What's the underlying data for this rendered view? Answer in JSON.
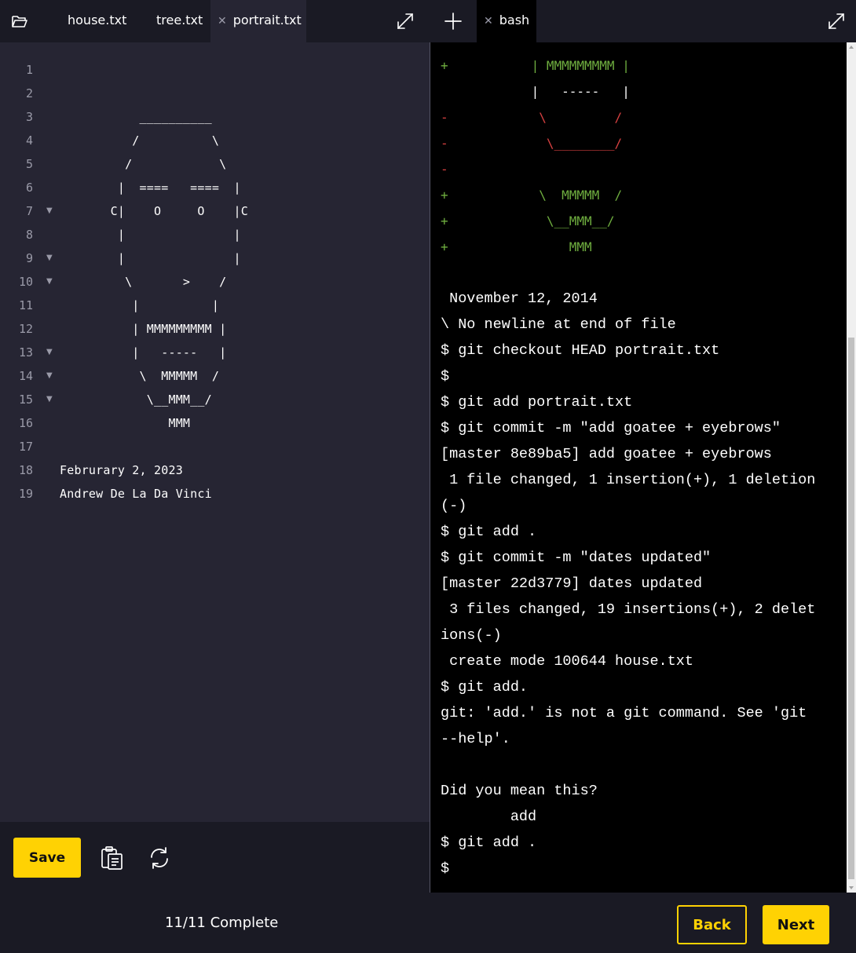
{
  "editor": {
    "tabs": [
      {
        "label": "house.txt",
        "active": false
      },
      {
        "label": "tree.txt",
        "active": false
      },
      {
        "label": "portrait.txt",
        "active": true
      }
    ],
    "lines": [
      {
        "n": "1",
        "text": "",
        "fold": ""
      },
      {
        "n": "2",
        "text": "",
        "fold": ""
      },
      {
        "n": "3",
        "text": "           __________",
        "fold": ""
      },
      {
        "n": "4",
        "text": "          /          \\",
        "fold": ""
      },
      {
        "n": "5",
        "text": "         /            \\",
        "fold": ""
      },
      {
        "n": "6",
        "text": "        |  ====   ====  |",
        "fold": ""
      },
      {
        "n": "7",
        "text": "       C|    O     O    |C",
        "fold": "▼"
      },
      {
        "n": "8",
        "text": "        |               |",
        "fold": ""
      },
      {
        "n": "9",
        "text": "        |               |",
        "fold": "▼"
      },
      {
        "n": "10",
        "text": "         \\       >    /",
        "fold": "▼"
      },
      {
        "n": "11",
        "text": "          |          |",
        "fold": ""
      },
      {
        "n": "12",
        "text": "          | MMMMMMMMM |",
        "fold": ""
      },
      {
        "n": "13",
        "text": "          |   -----   |",
        "fold": "▼"
      },
      {
        "n": "14",
        "text": "           \\  MMMMM  /",
        "fold": "▼"
      },
      {
        "n": "15",
        "text": "            \\__MMM__/",
        "fold": "▼"
      },
      {
        "n": "16",
        "text": "               MMM",
        "fold": ""
      },
      {
        "n": "17",
        "text": "",
        "fold": ""
      },
      {
        "n": "18",
        "text": "Februrary 2, 2023",
        "fold": ""
      },
      {
        "n": "19",
        "text": "Andrew De La Da Vinci",
        "fold": ""
      }
    ],
    "save_label": "Save"
  },
  "terminal": {
    "tab_label": "bash",
    "lines": [
      {
        "text": "+           | MMMMMMMMM |",
        "kind": "add"
      },
      {
        "text": "            |   -----   |",
        "kind": "ctx"
      },
      {
        "text": "-            \\         /",
        "kind": "del"
      },
      {
        "text": "-             \\________/",
        "kind": "del"
      },
      {
        "text": "-",
        "kind": "del"
      },
      {
        "text": "+            \\  MMMMM  /",
        "kind": "add"
      },
      {
        "text": "+             \\__MMM__/",
        "kind": "add"
      },
      {
        "text": "+                MMM",
        "kind": "add"
      },
      {
        "text": "",
        "kind": "plain"
      },
      {
        "text": " November 12, 2014",
        "kind": "plain"
      },
      {
        "text": "\\ No newline at end of file",
        "kind": "plain"
      },
      {
        "text": "$ git checkout HEAD portrait.txt",
        "kind": "plain"
      },
      {
        "text": "$",
        "kind": "plain"
      },
      {
        "text": "$ git add portrait.txt",
        "kind": "plain"
      },
      {
        "text": "$ git commit -m \"add goatee + eyebrows\"",
        "kind": "plain"
      },
      {
        "text": "[master 8e89ba5] add goatee + eyebrows",
        "kind": "plain"
      },
      {
        "text": " 1 file changed, 1 insertion(+), 1 deletion",
        "kind": "plain"
      },
      {
        "text": "(-)",
        "kind": "plain"
      },
      {
        "text": "$ git add .",
        "kind": "plain"
      },
      {
        "text": "$ git commit -m \"dates updated\"",
        "kind": "plain"
      },
      {
        "text": "[master 22d3779] dates updated",
        "kind": "plain"
      },
      {
        "text": " 3 files changed, 19 insertions(+), 2 delet",
        "kind": "plain"
      },
      {
        "text": "ions(-)",
        "kind": "plain"
      },
      {
        "text": " create mode 100644 house.txt",
        "kind": "plain"
      },
      {
        "text": "$ git add.",
        "kind": "plain"
      },
      {
        "text": "git: 'add.' is not a git command. See 'git",
        "kind": "plain"
      },
      {
        "text": "--help'.",
        "kind": "plain"
      },
      {
        "text": "",
        "kind": "plain"
      },
      {
        "text": "Did you mean this?",
        "kind": "plain"
      },
      {
        "text": "        add",
        "kind": "plain"
      },
      {
        "text": "$ git add .",
        "kind": "plain"
      },
      {
        "text": "$",
        "kind": "plain"
      }
    ]
  },
  "footer": {
    "status": "11/11 Complete",
    "back_label": "Back",
    "next_label": "Next"
  },
  "colors": {
    "accent": "#ffd203",
    "editor_bg": "#262533",
    "chrome_bg": "#1a1a24",
    "terminal_bg": "#000000",
    "diff_add": "#6fae3f",
    "diff_del": "#d64040"
  },
  "icons": {
    "folder": "folder-open-icon",
    "expand": "expand-icon",
    "plus": "plus-icon",
    "close": "close-icon",
    "clipboard": "clipboard-icon",
    "refresh": "refresh-icon"
  }
}
